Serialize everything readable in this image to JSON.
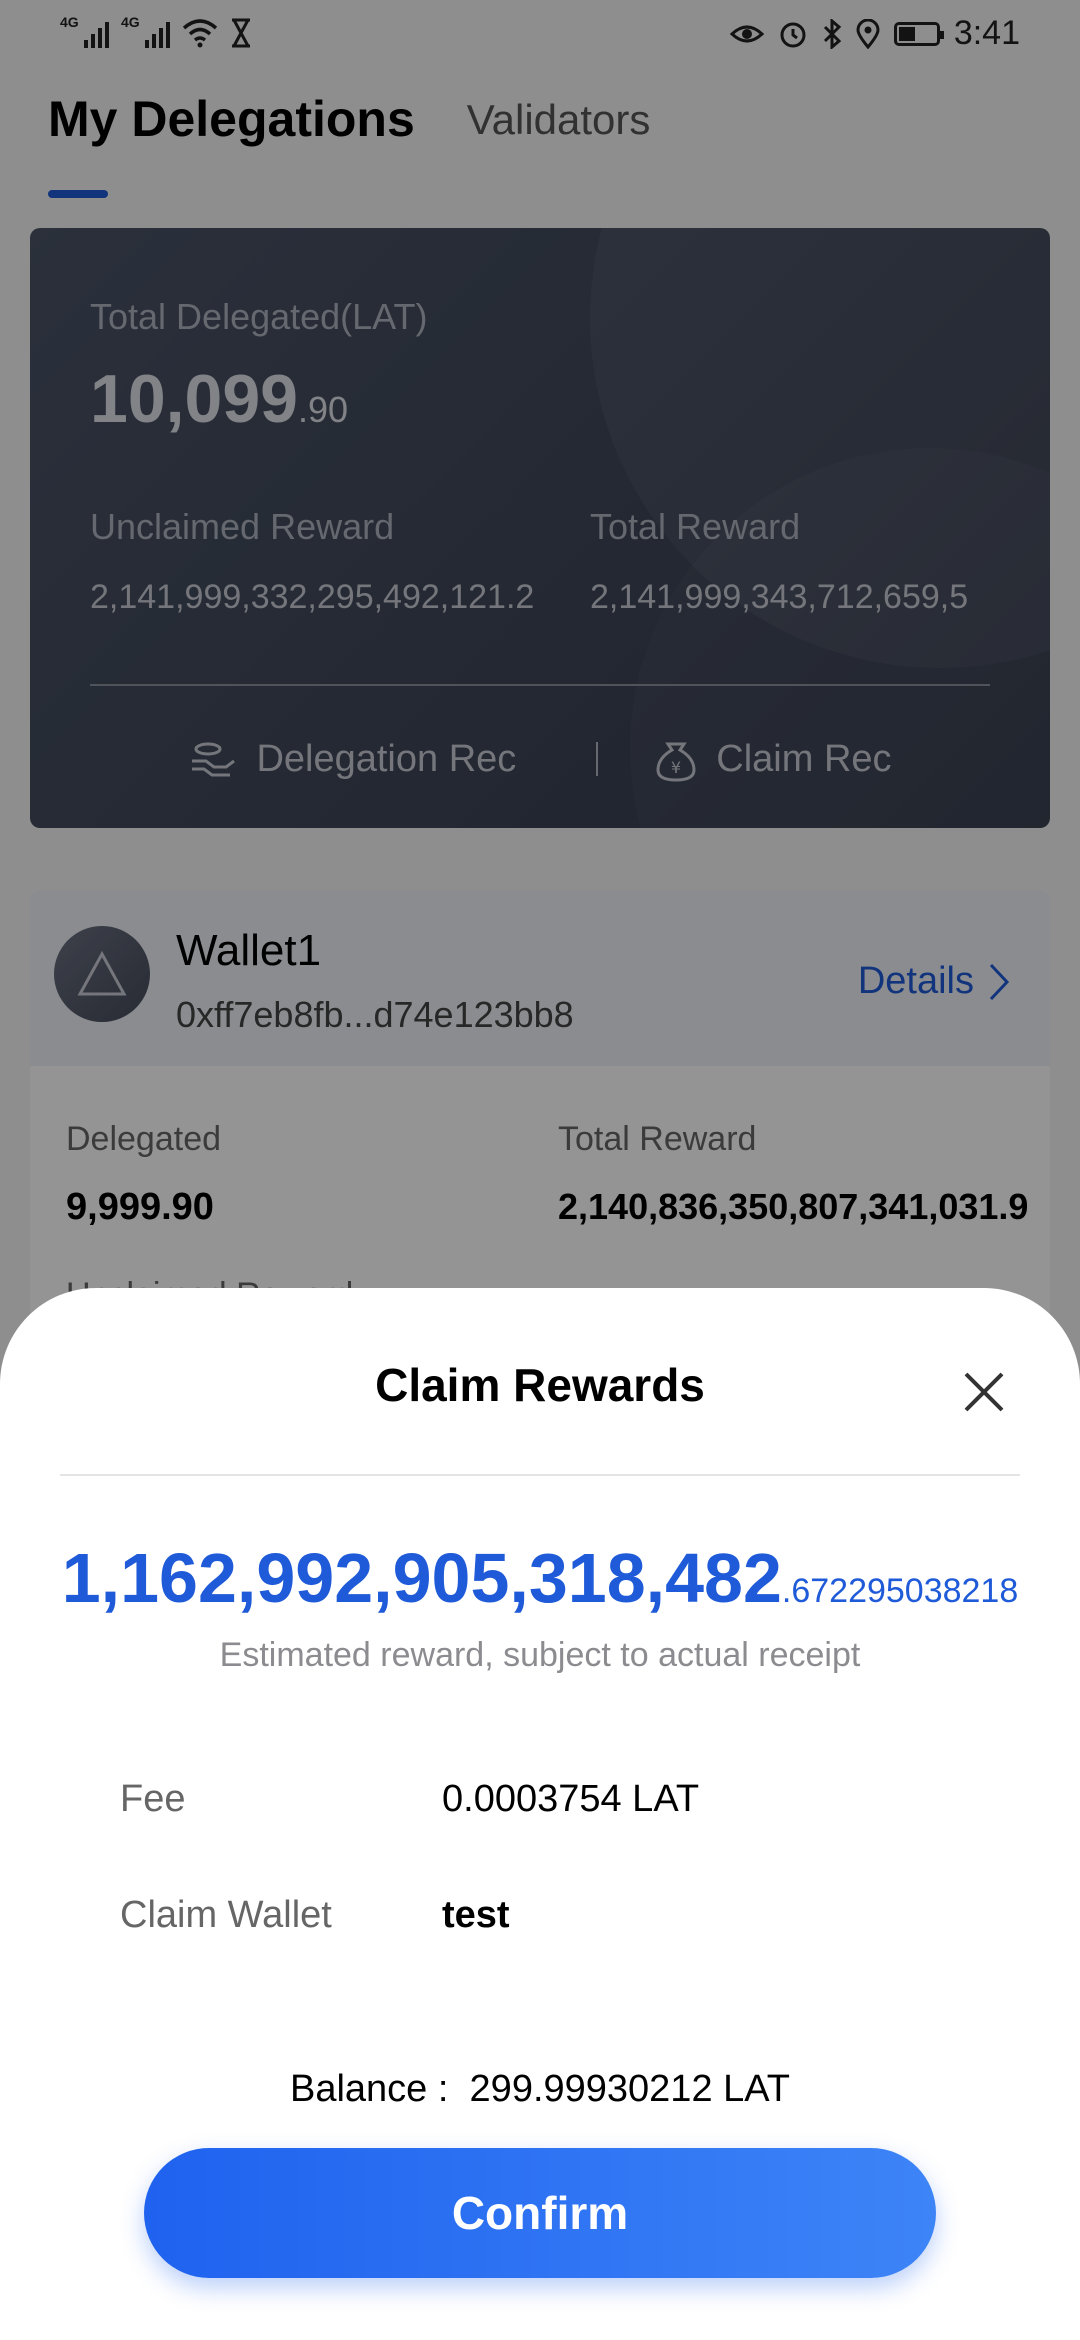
{
  "status_bar": {
    "time": "3:41",
    "network_1": "4G",
    "network_2": "4G"
  },
  "tabs": [
    {
      "label": "My Delegations",
      "active": true
    },
    {
      "label": "Validators",
      "active": false
    }
  ],
  "summary": {
    "total_label": "Total Delegated(LAT)",
    "total_int": "10,099",
    "total_dec": ".90",
    "unclaimed_label": "Unclaimed Reward",
    "unclaimed_value": "2,141,999,332,295,492,121.2",
    "total_reward_label": "Total Reward",
    "total_reward_value": "2,141,999,343,712,659,5",
    "delegation_rec_label": "Delegation Rec",
    "claim_rec_label": "Claim Rec"
  },
  "wallet": {
    "name": "Wallet1",
    "address": "0xff7eb8fb...d74e123bb8",
    "details_label": "Details",
    "delegated_label": "Delegated",
    "delegated_value": "9,999.90",
    "total_reward_label": "Total Reward",
    "total_reward_value": "2,140,836,350,807,341,031.9",
    "unclaimed_label": "Unclaimed Reward"
  },
  "sheet": {
    "title": "Claim Rewards",
    "reward_int": "1,162,992,905,318,482",
    "reward_frac": ".672295038218",
    "reward_note": "Estimated reward, subject to actual receipt",
    "fee_label": "Fee",
    "fee_value": "0.0003754 LAT",
    "wallet_label": "Claim Wallet",
    "wallet_value": "test",
    "balance_label": "Balance :",
    "balance_value": "299.99930212 LAT",
    "confirm_label": "Confirm"
  },
  "colors": {
    "accent": "#1f5bd8",
    "button": "#2f6ff3",
    "card_dark": "#3f4658"
  }
}
